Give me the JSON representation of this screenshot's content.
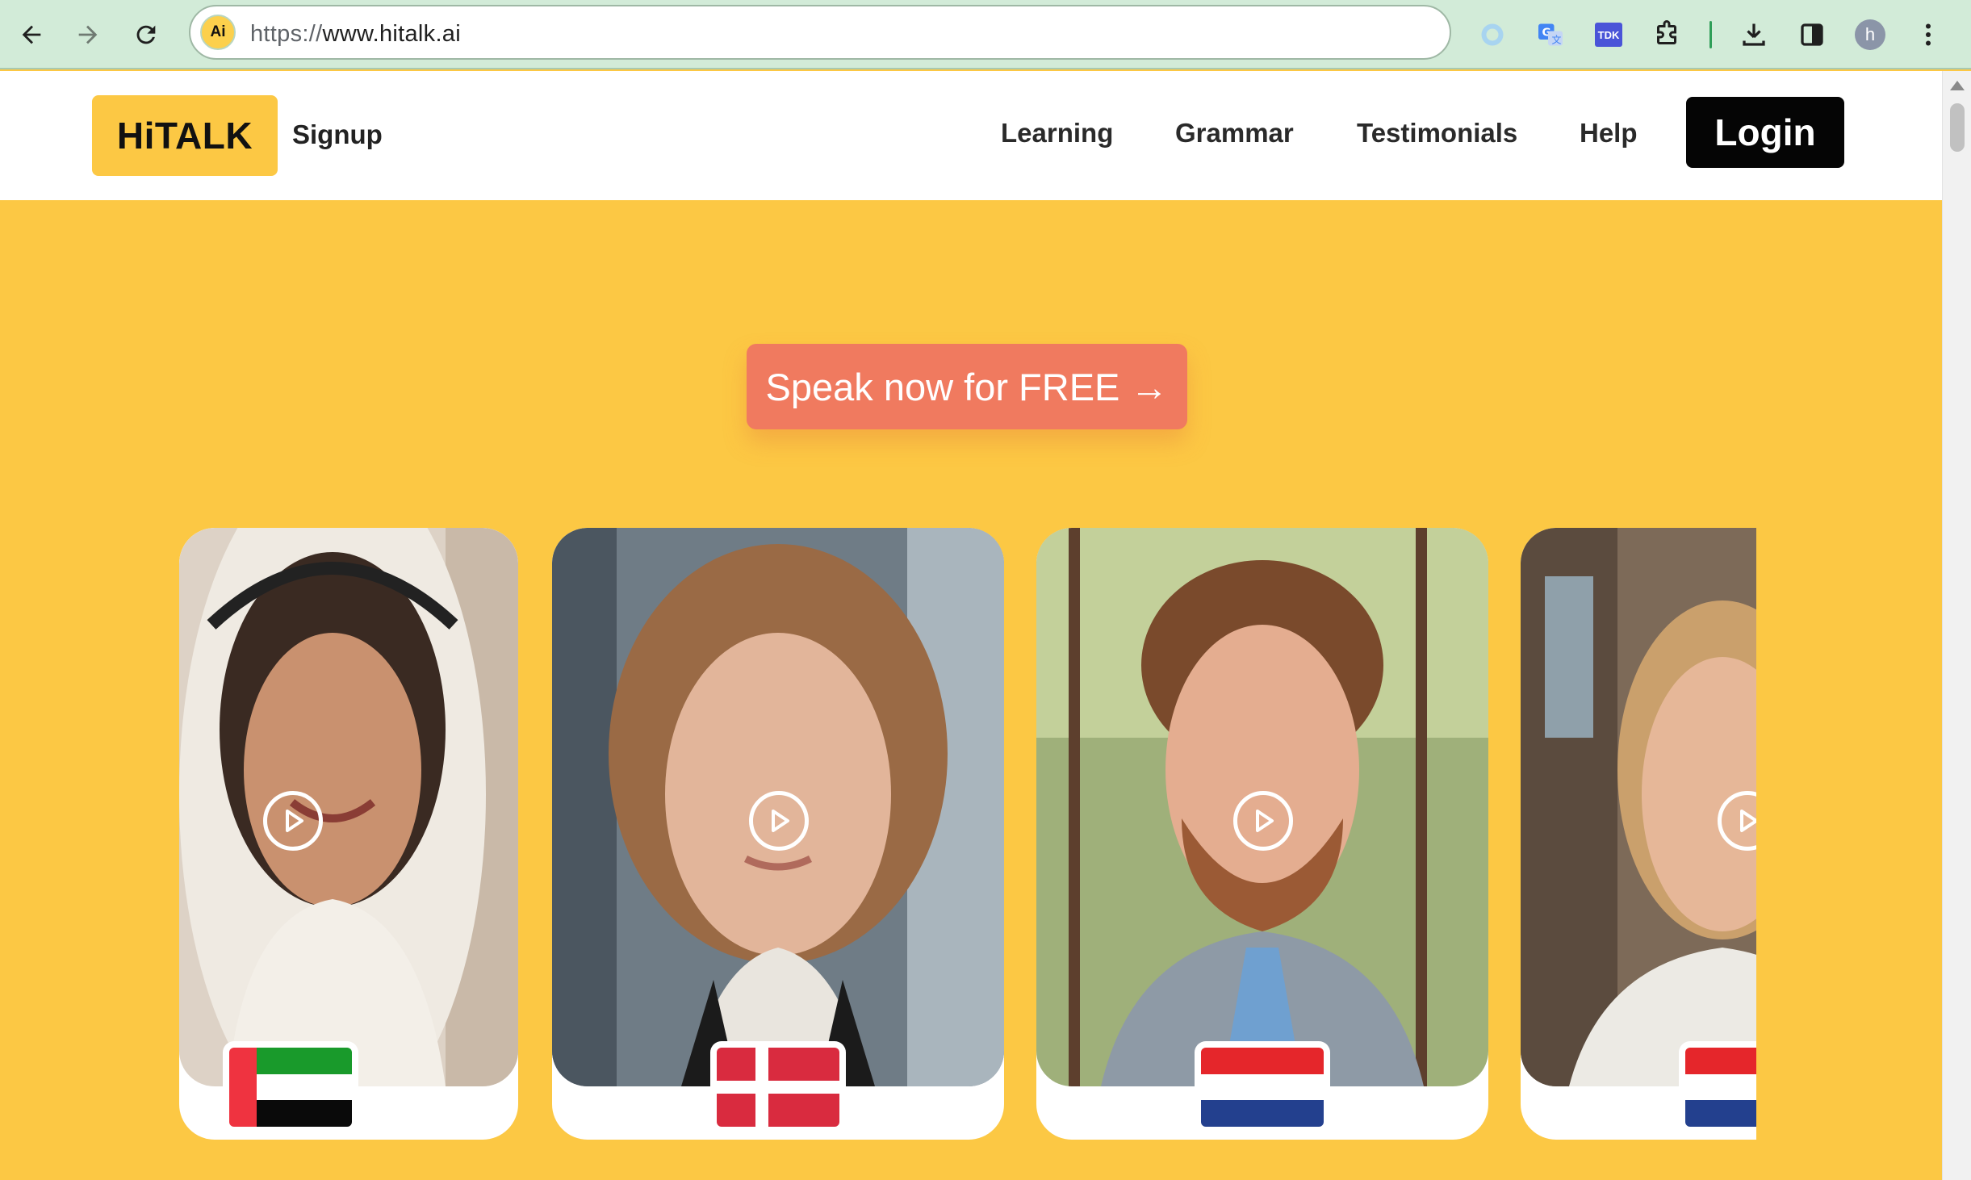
{
  "browser": {
    "url_scheme": "https://",
    "url_host": "www.hitalk.ai",
    "site_badge": "Ai",
    "profile_initial": "h",
    "extension_tdk_label": "TDK",
    "icons": [
      "back-icon",
      "forward-icon",
      "reload-icon",
      "circle-extension-icon",
      "translate-icon",
      "tdk-extension-icon",
      "puzzle-icon",
      "download-icon",
      "sidepanel-icon",
      "profile-avatar",
      "kebab-menu-icon"
    ]
  },
  "header": {
    "logo": "HiTALK",
    "signup": "Signup",
    "menu": [
      "Learning",
      "Grammar",
      "Testimonials",
      "Help"
    ],
    "login": "Login"
  },
  "hero": {
    "cta": "Speak now for FREE →"
  },
  "tutors": [
    {
      "flag": "United Arab Emirates",
      "icon": "play-icon"
    },
    {
      "flag": "Denmark",
      "icon": "play-icon"
    },
    {
      "flag": "Netherlands",
      "icon": "play-icon"
    },
    {
      "flag": "Netherlands",
      "icon": "play-icon"
    }
  ],
  "colors": {
    "brand_yellow": "#fcc844",
    "cta_coral": "#f07a5f",
    "login_black": "#050505",
    "chrome_green": "#d2ebd8"
  }
}
